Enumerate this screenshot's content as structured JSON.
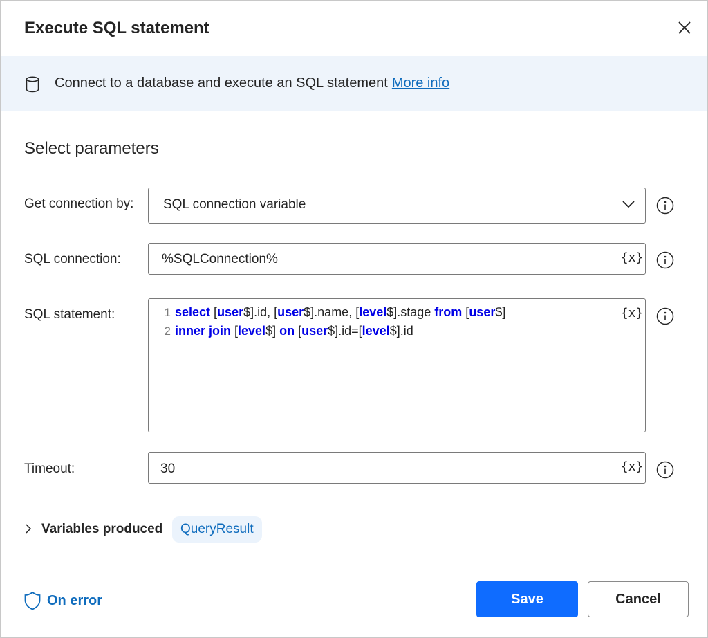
{
  "dialog": {
    "title": "Execute SQL statement",
    "close_icon": "close-icon"
  },
  "banner": {
    "icon": "database-icon",
    "description": "Connect to a database and execute an SQL statement",
    "link_label": "More info"
  },
  "section_title": "Select parameters",
  "fields": {
    "connection_by": {
      "label": "Get connection by:",
      "value": "SQL connection variable"
    },
    "sql_connection": {
      "label": "SQL connection:",
      "value": "%SQLConnection%",
      "var_button": "{x}"
    },
    "sql_statement": {
      "label": "SQL statement:",
      "var_button": "{x}",
      "line_numbers": [
        "1",
        "2"
      ],
      "lines": [
        [
          {
            "t": "select",
            "kw": true
          },
          {
            "t": " ["
          },
          {
            "t": "user",
            "kw": true
          },
          {
            "t": "$].id, ["
          },
          {
            "t": "user",
            "kw": true
          },
          {
            "t": "$].name, ["
          },
          {
            "t": "level",
            "kw": true
          },
          {
            "t": "$].stage "
          },
          {
            "t": "from",
            "kw": true
          },
          {
            "t": " ["
          },
          {
            "t": "user",
            "kw": true
          },
          {
            "t": "$]"
          }
        ],
        [
          {
            "t": "inner join",
            "kw": true
          },
          {
            "t": " ["
          },
          {
            "t": "level",
            "kw": true
          },
          {
            "t": "$] "
          },
          {
            "t": "on",
            "kw": true
          },
          {
            "t": " ["
          },
          {
            "t": "user",
            "kw": true
          },
          {
            "t": "$].id=["
          },
          {
            "t": "level",
            "kw": true
          },
          {
            "t": "$].id"
          }
        ]
      ]
    },
    "timeout": {
      "label": "Timeout:",
      "value": "30",
      "var_button": "{x}"
    }
  },
  "variables_produced": {
    "label": "Variables produced",
    "variables": [
      "QueryResult"
    ]
  },
  "footer": {
    "on_error_label": "On error",
    "save_label": "Save",
    "cancel_label": "Cancel"
  },
  "colors": {
    "accent": "#0f6cff",
    "link": "#0f6cbd",
    "banner_bg": "#eef4fb",
    "keyword": "#0000e6"
  }
}
